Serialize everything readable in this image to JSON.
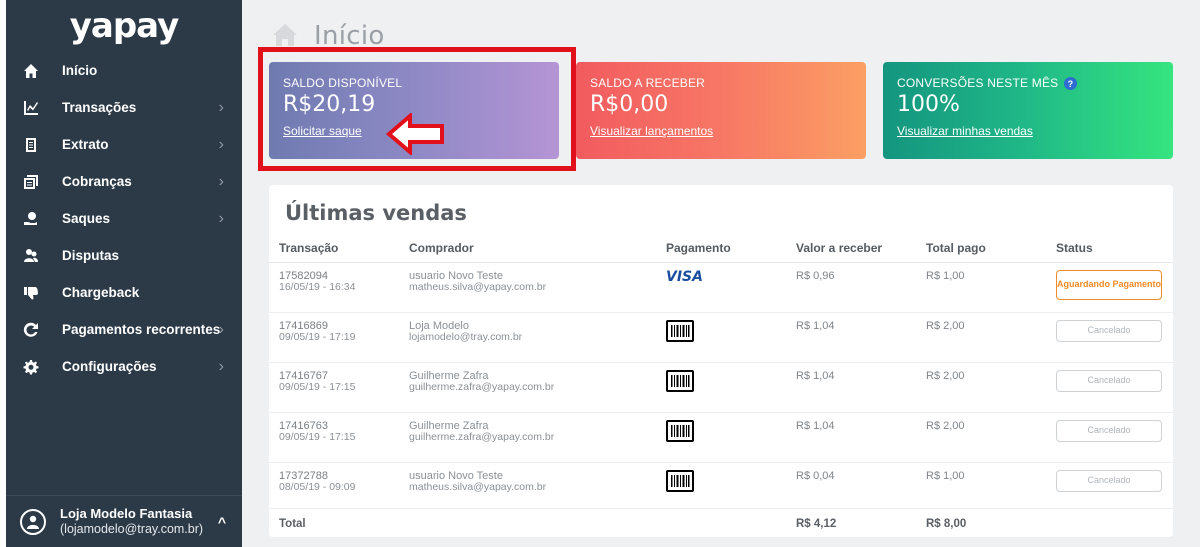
{
  "sidebar": {
    "logo": "yapay",
    "items": [
      {
        "label": "Início",
        "icon": "home-icon",
        "chevron": ""
      },
      {
        "label": "Transações",
        "icon": "chart-icon",
        "chevron": "›"
      },
      {
        "label": "Extrato",
        "icon": "document-icon",
        "chevron": "›"
      },
      {
        "label": "Cobranças",
        "icon": "invoices-icon",
        "chevron": "›"
      },
      {
        "label": "Saques",
        "icon": "coin-hand-icon",
        "chevron": "›"
      },
      {
        "label": "Disputas",
        "icon": "users-icon",
        "chevron": ""
      },
      {
        "label": "Chargeback",
        "icon": "thumbs-down-icon",
        "chevron": ""
      },
      {
        "label": "Pagamentos recorrentes",
        "icon": "refresh-icon",
        "chevron": "›"
      },
      {
        "label": "Configurações",
        "icon": "gear-icon",
        "chevron": "›"
      }
    ],
    "user": {
      "name": "Loja Modelo Fantasia",
      "email": "(lojamodelo@tray.com.br)",
      "toggle": "^"
    }
  },
  "header": {
    "title": "Início"
  },
  "cards": [
    {
      "label": "SALDO DISPONÍVEL",
      "value": "R$20,19",
      "link": "Solicitar saque",
      "help": ""
    },
    {
      "label": "SALDO A RECEBER",
      "value": "R$0,00",
      "link": "Visualizar lançamentos",
      "help": ""
    },
    {
      "label": "CONVERSÕES NESTE MÊS",
      "value": "100%",
      "link": "Visualizar minhas vendas",
      "help": "?"
    }
  ],
  "sales": {
    "title": "Últimas vendas",
    "columns": [
      "Transação",
      "Comprador",
      "Pagamento",
      "Valor a receber",
      "Total pago",
      "Status"
    ],
    "rows": [
      {
        "id": "17582094",
        "date": "16/05/19 - 16:34",
        "buyer": "usuario Novo Teste",
        "email": "matheus.silva@yapay.com.br",
        "payment": "VISA",
        "payment_type": "card",
        "value": "R$ 0,96",
        "total": "R$ 1,00",
        "status": "Aguardando Pagamento",
        "status_type": "pending"
      },
      {
        "id": "17416869",
        "date": "09/05/19 - 17:19",
        "buyer": "Loja Modelo",
        "email": "lojamodelo@tray.com.br",
        "payment": "",
        "payment_type": "boleto",
        "value": "R$ 1,04",
        "total": "R$ 2,00",
        "status": "Cancelado",
        "status_type": "cancelled"
      },
      {
        "id": "17416767",
        "date": "09/05/19 - 17:15",
        "buyer": "Guilherme Zafra",
        "email": "guilherme.zafra@yapay.com.br",
        "payment": "",
        "payment_type": "boleto",
        "value": "R$ 1,04",
        "total": "R$ 2,00",
        "status": "Cancelado",
        "status_type": "cancelled"
      },
      {
        "id": "17416763",
        "date": "09/05/19 - 17:15",
        "buyer": "Guilherme Zafra",
        "email": "guilherme.zafra@yapay.com.br",
        "payment": "",
        "payment_type": "boleto",
        "value": "R$ 1,04",
        "total": "R$ 2,00",
        "status": "Cancelado",
        "status_type": "cancelled"
      },
      {
        "id": "17372788",
        "date": "08/05/19 - 09:09",
        "buyer": "usuario Novo Teste",
        "email": "matheus.silva@yapay.com.br",
        "payment": "",
        "payment_type": "boleto",
        "value": "R$ 0,04",
        "total": "R$ 1,00",
        "status": "Cancelado",
        "status_type": "cancelled"
      }
    ],
    "total": {
      "label": "Total",
      "value": "R$ 4,12",
      "paid": "R$ 8,00"
    }
  },
  "colors": {
    "sidebar_bg": "#2c3a47",
    "highlight": "#e2101a",
    "pending": "#f08c28",
    "visa": "#1a4e9e"
  }
}
